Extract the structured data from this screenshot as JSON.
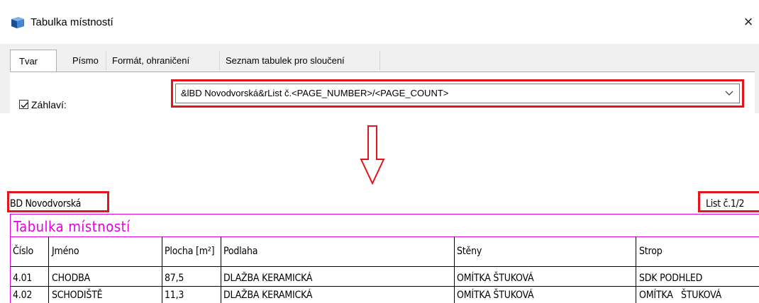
{
  "dialog": {
    "title": "Tabulka místností",
    "close_glyph": "×",
    "icon": "table-app-icon",
    "tabs": [
      {
        "label": "Tvar",
        "active": true
      },
      {
        "label": "Písmo",
        "active": false
      },
      {
        "label": "Formát, ohraničení",
        "active": false
      },
      {
        "label": "Seznam tabulek pro sloučení",
        "active": false
      }
    ],
    "header_checkbox": {
      "label": "Záhlaví:",
      "checked": true
    },
    "header_value": "&lBD Novodvorská&rList č.<PAGE_NUMBER>/<PAGE_COUNT>",
    "highlight_color": "#e3141a"
  },
  "arrow": {
    "icon": "down-arrow-icon",
    "color": "#e3141a"
  },
  "preview": {
    "header_left": "BD Novodvorská",
    "header_right": "List č.1/2",
    "table_title": "Tabulka místností",
    "table_color": "#e000e0",
    "columns": [
      "Číslo",
      "Jméno",
      "Plocha [m²]",
      "Podlaha",
      "Stěny",
      "Strop"
    ],
    "rows": [
      [
        "4.01",
        "CHODBA",
        "87,5",
        "DLAŽBA KERAMICKÁ",
        "OMÍTKA ŠTUKOVÁ",
        "SDK PODHLED"
      ],
      [
        "4.02",
        "SCHODIŠTĚ",
        "11,3",
        "DLAŽBA KERAMICKÁ",
        "OMÍTKA ŠTUKOVÁ",
        "OMÍTKA   ŠTUKOVÁ"
      ]
    ]
  }
}
